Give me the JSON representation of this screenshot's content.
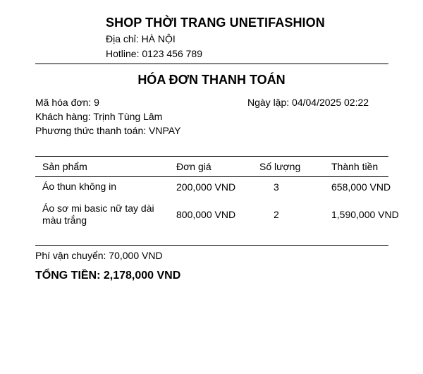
{
  "shop": {
    "name": "SHOP THỜI TRANG UNETIFASHION",
    "address": "Địa chỉ: HÀ NỘI",
    "hotline": "Hotline: 0123 456 789"
  },
  "invoice": {
    "title": "HÓA ĐƠN THANH TOÁN",
    "number": "Mã hóa đơn: 9",
    "date": "Ngày lập: 04/04/2025 02:22",
    "customer": "Khách hàng: Trịnh Tùng Lâm",
    "payment": "Phương thức thanh toán: VNPAY"
  },
  "table": {
    "headers": [
      "Sản phẩm",
      "Đơn giá",
      "Số lượng",
      "Thành tiền"
    ],
    "rows": [
      [
        "Áo thun không in",
        "200,000 VND",
        "3",
        "658,000 VND"
      ],
      [
        "Áo sơ mi basic nữ tay dài màu trắng",
        "800,000 VND",
        "2",
        "1,590,000 VND"
      ]
    ]
  },
  "summary": {
    "shipping": "Phí vận chuyển: 70,000 VND",
    "total": "TỔNG TIỀN: 2,178,000 VND"
  }
}
